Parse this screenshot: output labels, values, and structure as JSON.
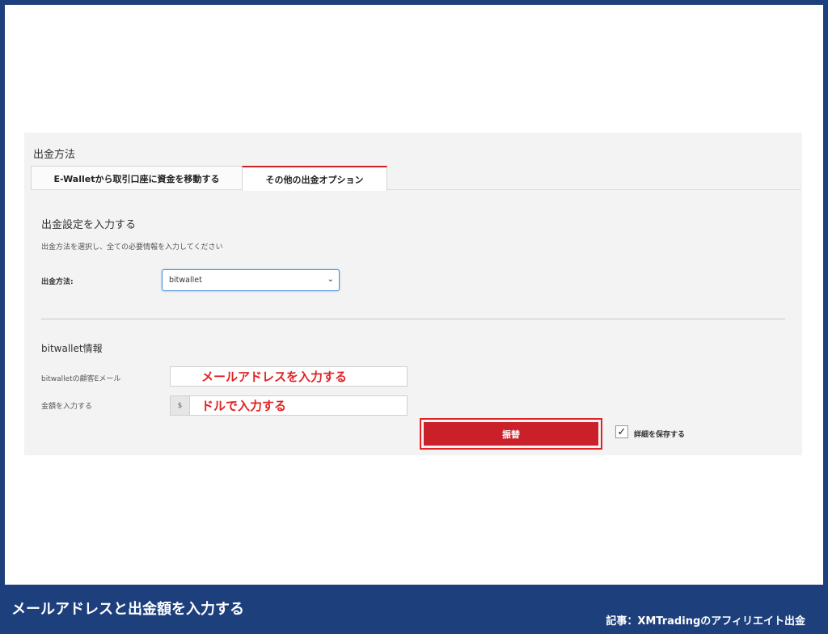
{
  "panel": {
    "title": "出金方法",
    "tabs": [
      {
        "label": "E-Walletから取引口座に資金を移動する"
      },
      {
        "label": "その他の出金オプション"
      }
    ],
    "active_tab_color": "#c9202a"
  },
  "withdrawal": {
    "section_title": "出金設定を入力する",
    "description": "出金方法を選択し、全ての必要情報を入力してください",
    "method_label": "出金方法:",
    "method_value": "bitwallet"
  },
  "bitwallet": {
    "title": "bitwallet情報",
    "email_label": "bitwalletの顧客Eメール",
    "email_hint": "メールアドレスを入力する",
    "amount_label": "金額を入力する",
    "currency_symbol": "$",
    "amount_hint": "ドルで入力する",
    "submit_label": "振替",
    "save_details_label": "詳細を保存する",
    "save_details_checked": true
  },
  "annotation_color": "#e02424",
  "footer": {
    "caption": "メールアドレスと出金額を入力する",
    "source": "記事：XMTradingのアフィリエイト出金"
  }
}
